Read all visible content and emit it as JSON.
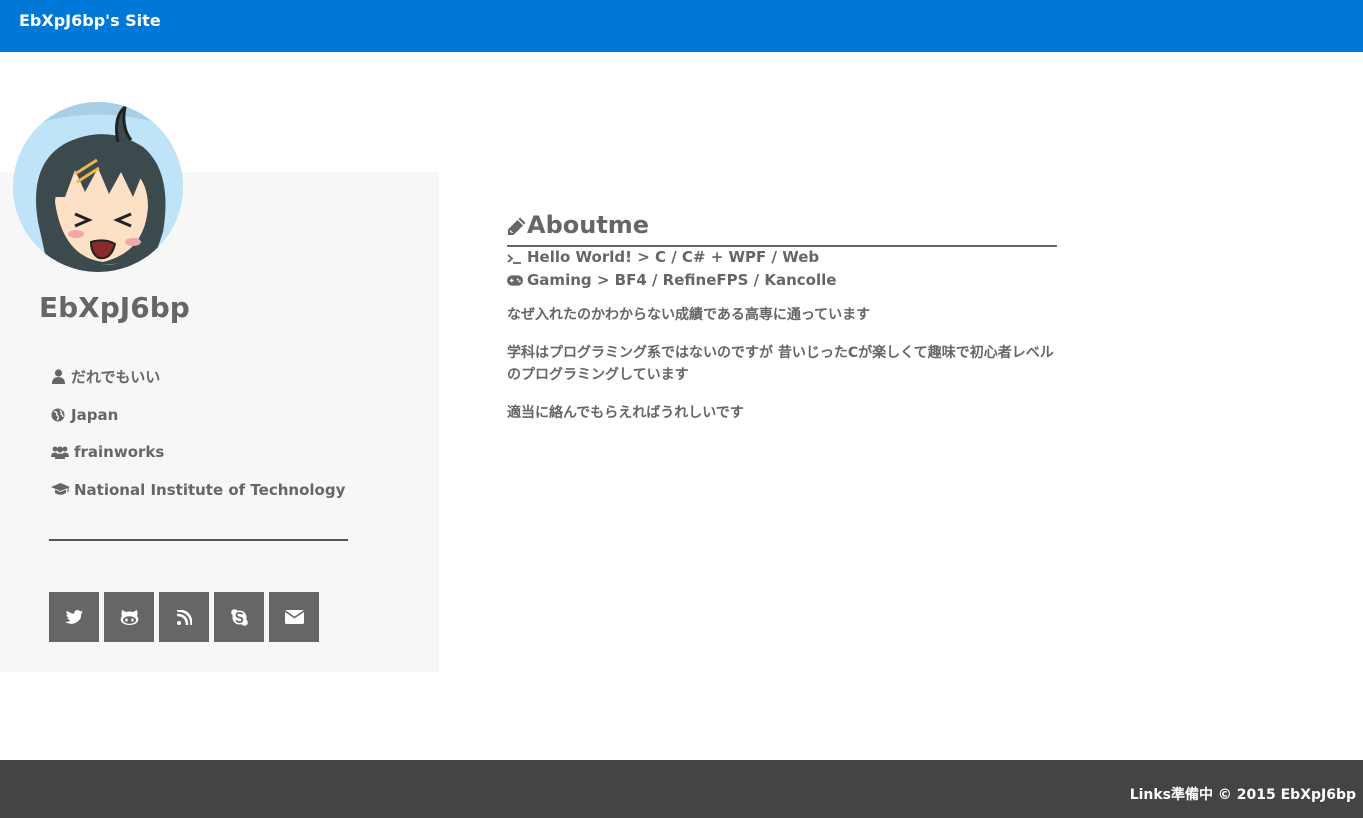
{
  "header": {
    "site_title": "EbXpJ6bp's Site",
    "color": "#0078d7"
  },
  "sidebar": {
    "avatar_icon": "avatar-image",
    "name": "EbXpJ6bp",
    "info": [
      {
        "icon": "user-icon",
        "text": "だれでもいい"
      },
      {
        "icon": "globe-icon",
        "text": "Japan"
      },
      {
        "icon": "users-icon",
        "text": "frainworks"
      },
      {
        "icon": "graduation-cap-icon",
        "text": "National Institute of Technology"
      }
    ],
    "social": [
      {
        "icon": "twitter-icon"
      },
      {
        "icon": "github-icon"
      },
      {
        "icon": "rss-icon"
      },
      {
        "icon": "skype-icon"
      },
      {
        "icon": "envelope-icon"
      }
    ]
  },
  "about": {
    "heading": "Aboutme",
    "lines": [
      {
        "icon": "terminal-icon",
        "text": "Hello World! > C / C# + WPF / Web"
      },
      {
        "icon": "gamepad-icon",
        "text": "Gaming > BF4 / RefineFPS / Kancolle"
      }
    ],
    "paragraphs": [
      "なぜ入れたのかわからない成績である高専に通っています",
      "学科はプログラミング系ではないのですが 昔いじったCが楽しくて趣味で初心者レベルのプログラミングしています",
      "適当に絡んでもらえればうれしいです"
    ]
  },
  "footer": {
    "text": "Links準備中 © 2015 EbXpJ6bp",
    "color": "#444444"
  }
}
